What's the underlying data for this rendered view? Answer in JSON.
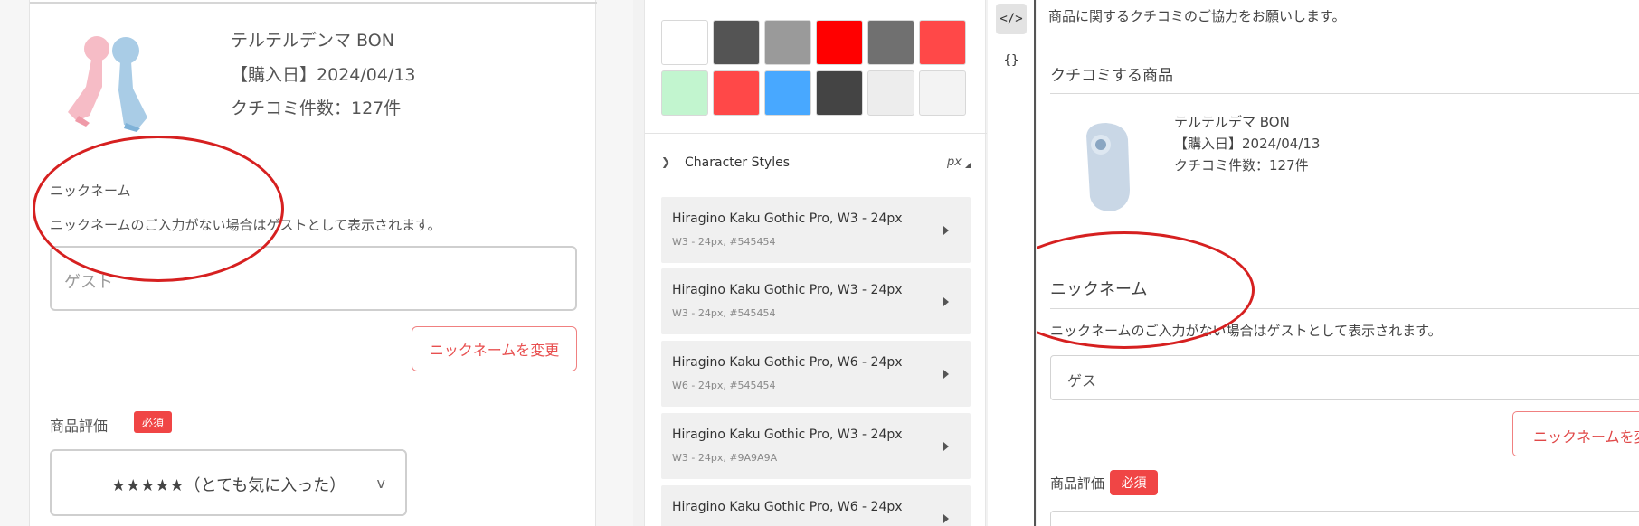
{
  "mockup": {
    "product_name": "テルテルデンマ BON",
    "purchase_date": "【購入日】2024/04/13",
    "review_count": "クチコミ件数：127件",
    "nickname_label": "ニックネーム",
    "nickname_note": "ニックネームのご入力がない場合はゲストとして表示されます。",
    "nickname_value": "ゲスト",
    "change_nickname_button": "ニックネームを変更",
    "rating_label": "商品評価",
    "required_badge": "必須",
    "rating_value": "★★★★★（とても気に入った）",
    "rating_chevron": "v"
  },
  "inspector": {
    "swatches": [
      "#ffffff",
      "#545454",
      "#9a9a9a",
      "#ff0000",
      "#707070",
      "#ff4848",
      "#c2f5cf",
      "#ff4848",
      "#48a8ff",
      "#444444",
      "#ededed",
      "#f3f3f3"
    ],
    "character_styles_title": "Character Styles",
    "unit": "px",
    "styles": [
      {
        "name": "Hiragino Kaku Gothic Pro, W3 - 24px",
        "desc": "W3 - 24px, #545454"
      },
      {
        "name": "Hiragino Kaku Gothic Pro, W3 - 24px",
        "desc": "W3 - 24px, #545454"
      },
      {
        "name": "Hiragino Kaku Gothic Pro, W6 - 24px",
        "desc": "W6 - 24px, #545454"
      },
      {
        "name": "Hiragino Kaku Gothic Pro, W3 - 24px",
        "desc": "W3 - 24px, #9A9A9A"
      },
      {
        "name": "Hiragino Kaku Gothic Pro, W6 - 24px",
        "desc": ""
      }
    ]
  },
  "tools": {
    "code_icon_label": "</>",
    "json_icon_label": "{}"
  },
  "preview": {
    "intro": "商品に関するクチコミのご協力をお願いします。",
    "section_title": "クチコミする商品",
    "product_name": "テルテルデマ BON",
    "purchase_date": "【購入日】2024/04/13",
    "review_count": "クチコミ件数：127件",
    "nickname_label": "ニックネーム",
    "nickname_note": "ニックネームのご入力がない場合はゲストとして表示されます。",
    "nickname_value": "ゲス",
    "change_nickname_button": "ニックネームを変",
    "rating_label": "商品評価",
    "required_badge": "必須"
  },
  "colors": {
    "accent_red": "#f04545",
    "annotation_red": "#d62020",
    "text_main": "#545454"
  }
}
